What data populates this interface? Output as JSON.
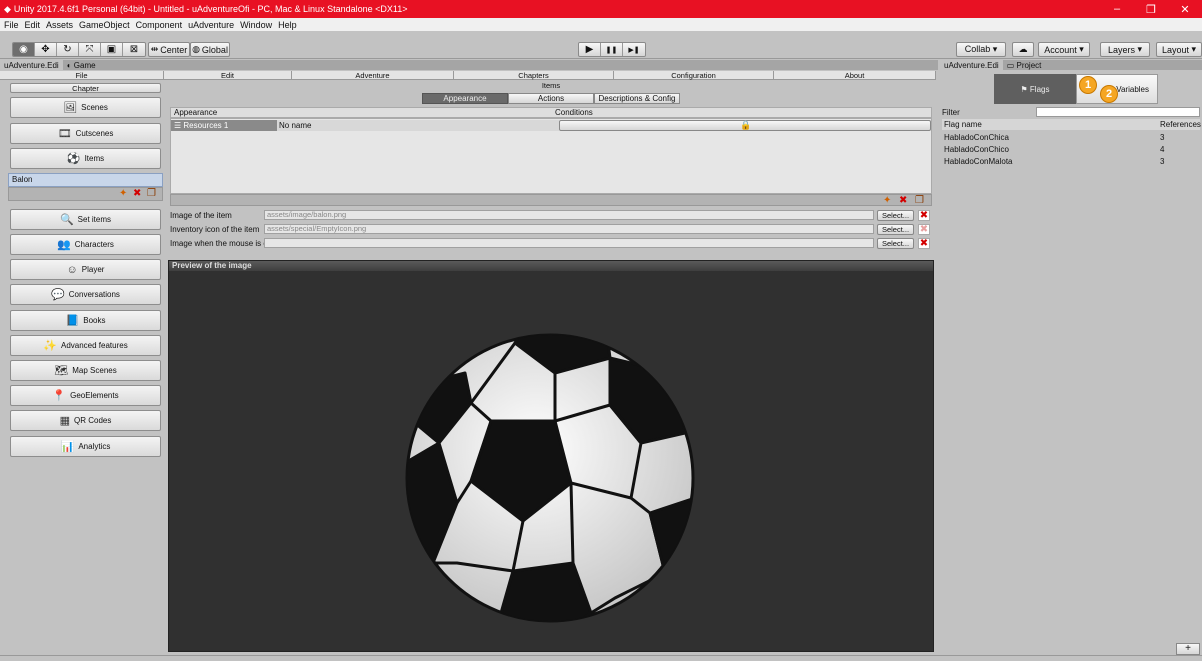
{
  "window": {
    "title": "Unity 2017.4.6f1 Personal (64bit) - Untitled - uAdventureOfi - PC, Mac & Linux Standalone <DX11>",
    "controls": [
      "–",
      "❐",
      "✕"
    ]
  },
  "menu": [
    "File",
    "Edit",
    "Assets",
    "GameObject",
    "Component",
    "uAdventure",
    "Window",
    "Help"
  ],
  "toolbar": {
    "center_label": "Center",
    "global_label": "Global",
    "play_icons": [
      "▶",
      "❚❚",
      "▶❚"
    ],
    "collab_label": "Collab ▾",
    "cloud_icon": "cloud-icon",
    "account_label": "Account",
    "layers_label": "Layers",
    "layout_label": "Layout"
  },
  "tabs_left": [
    "uAdventure.Edi",
    "Game"
  ],
  "tabs_right": [
    "uAdventure.Edi",
    "Project"
  ],
  "topnav": [
    "File",
    "Edit",
    "Adventure",
    "Chapters",
    "Configuration",
    "About"
  ],
  "sidebar": {
    "chapter_label": "Chapter",
    "items": [
      {
        "label": "Scenes",
        "icon": "scenes-icon",
        "glyph": "🖼"
      },
      {
        "label": "Cutscenes",
        "icon": "cutscenes-icon",
        "glyph": "🎞"
      },
      {
        "label": "Items",
        "icon": "items-icon",
        "glyph": "⚽"
      },
      {
        "label": "Set items",
        "icon": "set-items-icon",
        "glyph": "🔍"
      },
      {
        "label": "Characters",
        "icon": "characters-icon",
        "glyph": "👥"
      },
      {
        "label": "Player",
        "icon": "player-icon",
        "glyph": "☺"
      },
      {
        "label": "Conversations",
        "icon": "conversations-icon",
        "glyph": "💬"
      },
      {
        "label": "Books",
        "icon": "books-icon",
        "glyph": "📘"
      },
      {
        "label": "Advanced features",
        "icon": "advanced-icon",
        "glyph": "✨"
      },
      {
        "label": "Map Scenes",
        "icon": "map-scenes-icon",
        "glyph": "🗺"
      },
      {
        "label": "GeoElements",
        "icon": "geo-icon",
        "glyph": "📍"
      },
      {
        "label": "QR Codes",
        "icon": "qr-icon",
        "glyph": "▦"
      },
      {
        "label": "Analytics",
        "icon": "analytics-icon",
        "glyph": "📊"
      }
    ],
    "selected_item": "Balon"
  },
  "main": {
    "section_title": "Items",
    "subtabs": [
      "Appearance",
      "Actions",
      "Descriptions & Config"
    ],
    "active_subtab": "Appearance",
    "table_headers": [
      "Appearance",
      "Conditions"
    ],
    "resource_row": {
      "name": "Resources 1",
      "value": "No name"
    },
    "fields": [
      {
        "label": "Image of the item",
        "value": "assets/image/balon.png",
        "select": "Select..."
      },
      {
        "label": "Inventory icon of the item",
        "value": "assets/special/EmptyIcon.png",
        "select": "Select..."
      },
      {
        "label": "Image when the mouse is over",
        "value": "",
        "select": "Select..."
      }
    ],
    "preview_title": "Preview of the image"
  },
  "right": {
    "flags_label": "Flags",
    "variables_label": "Variables",
    "badge1": "1",
    "badge2": "2",
    "filter_label": "Filter",
    "headers": [
      "Flag name",
      "References"
    ],
    "rows": [
      {
        "name": "HabladoConChica",
        "refs": "3"
      },
      {
        "name": "HabladoConChico",
        "refs": "4"
      },
      {
        "name": "HabladoConMalota",
        "refs": "3"
      }
    ],
    "add_label": "+"
  },
  "colors": {
    "titlebar": "#e81123",
    "editor_bg": "#c2c2c2",
    "preview_bg": "#303030",
    "selection": "#c8d6ea"
  }
}
